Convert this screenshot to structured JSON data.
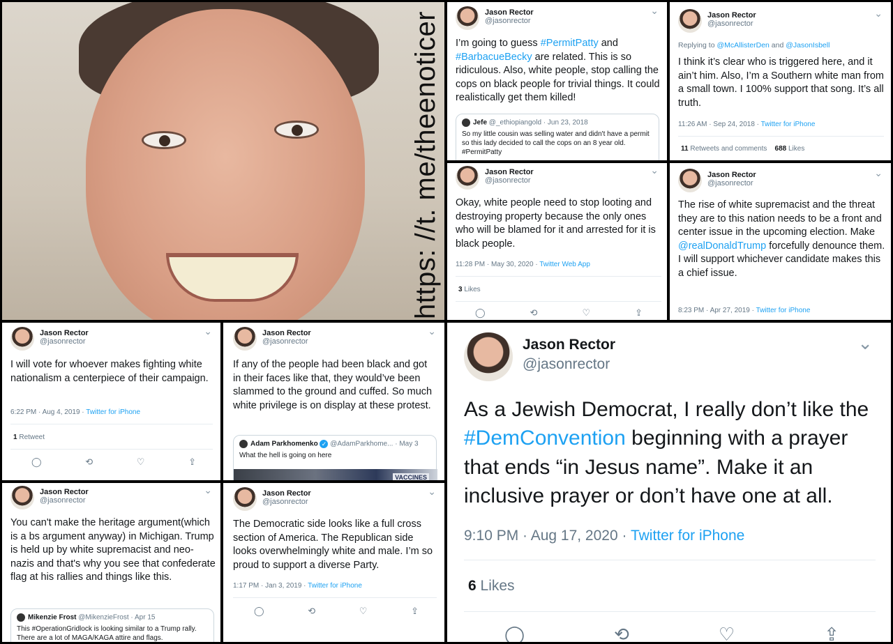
{
  "watermark": "https: //t. me/theenoticer",
  "icons": {
    "reply": "reply-icon",
    "retweet": "retweet-icon",
    "like": "heart-icon",
    "share": "share-icon",
    "more": "chevron-down-icon"
  },
  "glyphs": {
    "reply": "◯",
    "retweet": "⟲",
    "like": "♡",
    "share": "⇪",
    "more": "⌄"
  },
  "author": {
    "name": "Jason Rector",
    "handle": "@jasonrector"
  },
  "t1": {
    "pre": "I’m going to guess ",
    "tag1": "#PermitPatty",
    "mid": " and",
    "tag2": "#BarbacueBecky",
    "post": " are related. This is so ridiculous. Also, white people, stop calling the cops on black people for trivial things. It could realistically get them killed!",
    "quote": {
      "name": "Jefe",
      "handle": "@_ethiopiangold",
      "date": " · Jun 23, 2018",
      "text": "So my little cousin was selling water and didn't have a permit so this lady decided to call the cops on an 8 year old. #PermitPatty"
    }
  },
  "t2": {
    "replying_pre": "Replying to ",
    "replying_a": "@McAllisterDen",
    "replying_and": " and ",
    "replying_b": "@JasonIsbell",
    "text": "I think it’s clear who is triggered here, and it ain’t him. Also, I’m a Southern white man from a small town. I 100% support that song. It’s all truth.",
    "time": "11:26 AM · Sep 24, 2018 · ",
    "source": "Twitter for iPhone",
    "retweets_n": "11",
    "retweets_label": " Retweets and comments",
    "likes_n": "688",
    "likes_label": " Likes"
  },
  "t3": {
    "text": "Okay, white people need to stop looting and destroying property because the only ones who will be blamed for it and arrested for it is black people.",
    "time": "11:28 PM · May 30, 2020 · ",
    "source": "Twitter Web App",
    "likes_n": "3",
    "likes_label": " Likes"
  },
  "t4": {
    "pre": "The rise of white supremacist and the threat they are to this nation needs to be a front and center issue in the upcoming election. Make ",
    "mention": "@realDonaldTrump",
    "post": " forcefully denounce them. I will support whichever candidate makes this a chief issue.",
    "time": "8:23 PM · Apr 27, 2019 · ",
    "source": "Twitter for iPhone"
  },
  "t5": {
    "text": "I will vote for whoever makes fighting white nationalism a centerpiece of their campaign.",
    "time": "6:22 PM · Aug 4, 2019 · ",
    "source": "Twitter for iPhone",
    "retweets_n": "1",
    "retweets_label": " Retweet"
  },
  "t6": {
    "text": "If any of the people had been black and got in their faces like that, they would’ve been slammed to the ground and cuffed. So much white privilege is on display at these protest.",
    "quote": {
      "name": "Adam Parkhomenko",
      "handle": "@AdamParkhome...",
      "date": " · May 3",
      "text": "What the hell is going on here",
      "sign": "VACCINES"
    }
  },
  "t7": {
    "pre": "As a Jewish Democrat, I really don’t like the ",
    "tag": "#DemConvention",
    "post": " beginning with a prayer that ends “in Jesus name”. Make it an inclusive prayer or don’t have one at all.",
    "time": "9:10 PM · Aug 17, 2020 · ",
    "source": "Twitter for iPhone",
    "likes_n": "6",
    "likes_label": " Likes"
  },
  "t8": {
    "text": "You can't make the heritage argument(which is a bs argument anyway) in Michigan. Trump is held up by white supremacist and neo-nazis and that's why you see that confederate flag at his rallies and things like this.",
    "quote": {
      "name": "Mikenzie Frost",
      "handle": "@MikenzieFrost",
      "date": " · Apr 15",
      "text": "This #OperationGridlock is looking similar to a Trump rally. There are a lot of MAGA/KAGA attire and flags."
    }
  },
  "t9": {
    "text": "The Democratic side looks like a full cross section of America. The Republican side looks overwhelmingly white and male. I’m so proud to support a diverse Party.",
    "time": "1:17 PM · Jan 3, 2019 · ",
    "source": "Twitter for iPhone"
  }
}
